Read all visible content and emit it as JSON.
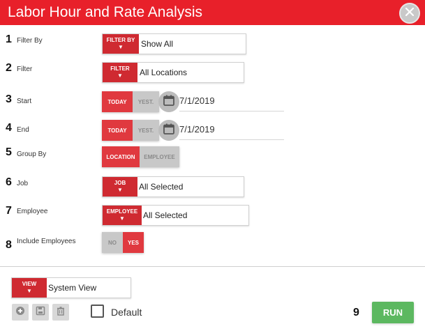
{
  "dialog": {
    "title": "Labor Hour and Rate Analysis",
    "close_icon": "close-icon"
  },
  "fields": {
    "filter_by": {
      "num": "1",
      "label": "Filter By",
      "tag": "FILTER BY",
      "value": "Show All"
    },
    "filter": {
      "num": "2",
      "label": "Filter",
      "tag": "FILTER",
      "value": "All Locations"
    },
    "start": {
      "num": "3",
      "label": "Start",
      "opt_today": "TODAY",
      "opt_yest": "YEST.",
      "date": "7/1/2019"
    },
    "end": {
      "num": "4",
      "label": "End",
      "opt_today": "TODAY",
      "opt_yest": "YEST.",
      "date": "7/1/2019"
    },
    "group_by": {
      "num": "5",
      "label": "Group By",
      "opt_location": "LOCATION",
      "opt_employee": "EMPLOYEE",
      "selected": "LOCATION"
    },
    "job": {
      "num": "6",
      "label": "Job",
      "tag": "JOB",
      "value": "All Selected"
    },
    "employee": {
      "num": "7",
      "label": "Employee",
      "tag": "EMPLOYEE",
      "value": "All Selected"
    },
    "include_employees": {
      "num": "8",
      "label": "Include Employees",
      "opt_no": "NO",
      "opt_yes": "YES",
      "selected": "YES"
    }
  },
  "footer": {
    "view_tag": "VIEW",
    "view_value": "System View",
    "default_label": "Default",
    "default_checked": false,
    "run_num": "9",
    "run_label": "RUN",
    "icons": [
      "add-icon",
      "save-icon",
      "delete-icon"
    ]
  },
  "colors": {
    "header": "#e8202a",
    "accent_red": "#cf2a31",
    "toggle_on": "#e0393f",
    "toggle_off": "#c8c8c8",
    "run": "#5cb860"
  }
}
